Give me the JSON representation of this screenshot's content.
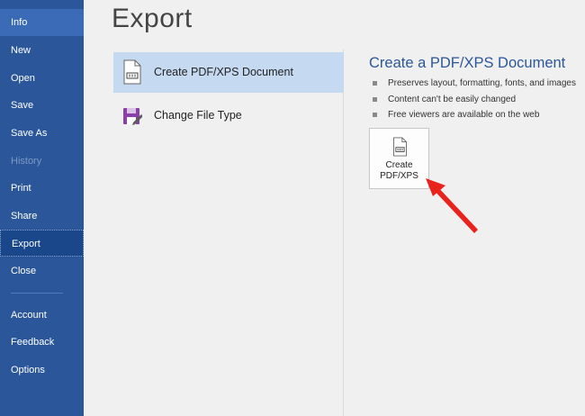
{
  "sidebar": {
    "items": [
      {
        "label": "Info"
      },
      {
        "label": "New"
      },
      {
        "label": "Open"
      },
      {
        "label": "Save"
      },
      {
        "label": "Save As"
      },
      {
        "label": "History"
      },
      {
        "label": "Print"
      },
      {
        "label": "Share"
      },
      {
        "label": "Export"
      },
      {
        "label": "Close"
      },
      {
        "label": "Account"
      },
      {
        "label": "Feedback"
      },
      {
        "label": "Options"
      }
    ],
    "active_item": "Export",
    "disabled_item": "History"
  },
  "main": {
    "title": "Export",
    "options": [
      {
        "label": "Create PDF/XPS Document",
        "icon": "pdf-document-icon",
        "selected": true
      },
      {
        "label": "Change File Type",
        "icon": "change-file-type-icon",
        "selected": false
      }
    ],
    "detail": {
      "title": "Create a PDF/XPS Document",
      "bullets": [
        "Preserves layout, formatting, fonts, and images",
        "Content can't be easily changed",
        "Free viewers are available on the web"
      ],
      "button_label": "Create\nPDF/XPS",
      "button_icon": "pdf-document-icon"
    }
  },
  "colors": {
    "sidebar_bg": "#2b579a",
    "sidebar_active": "#19478a",
    "selected_option_bg": "#c5d9f1",
    "accent_title": "#2b579a",
    "annotation_arrow": "#e8231b"
  },
  "annotation": {
    "type": "arrow",
    "points_to": "create-pdf-xps-button"
  }
}
